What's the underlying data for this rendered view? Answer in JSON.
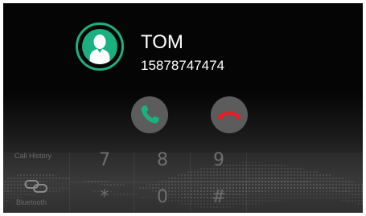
{
  "caller": {
    "name": "TOM",
    "number": "15878747474",
    "avatar_icon": "person-avatar-icon"
  },
  "actions": {
    "answer_icon": "phone-answer-icon",
    "hangup_icon": "phone-hangup-icon"
  },
  "dialpad": {
    "keys_row1": [
      "7",
      "8",
      "9"
    ],
    "keys_row2": [
      "*",
      "0",
      "#"
    ]
  },
  "sidebar": {
    "call_history_label": "Call History",
    "bluetooth_label": "Bluetooth",
    "link_icon": "link-icon"
  },
  "colors": {
    "accent": "#1bb07f",
    "answer": "#1bb07f",
    "hangup": "#e0202a",
    "button_bg": "#5c5c5c"
  }
}
